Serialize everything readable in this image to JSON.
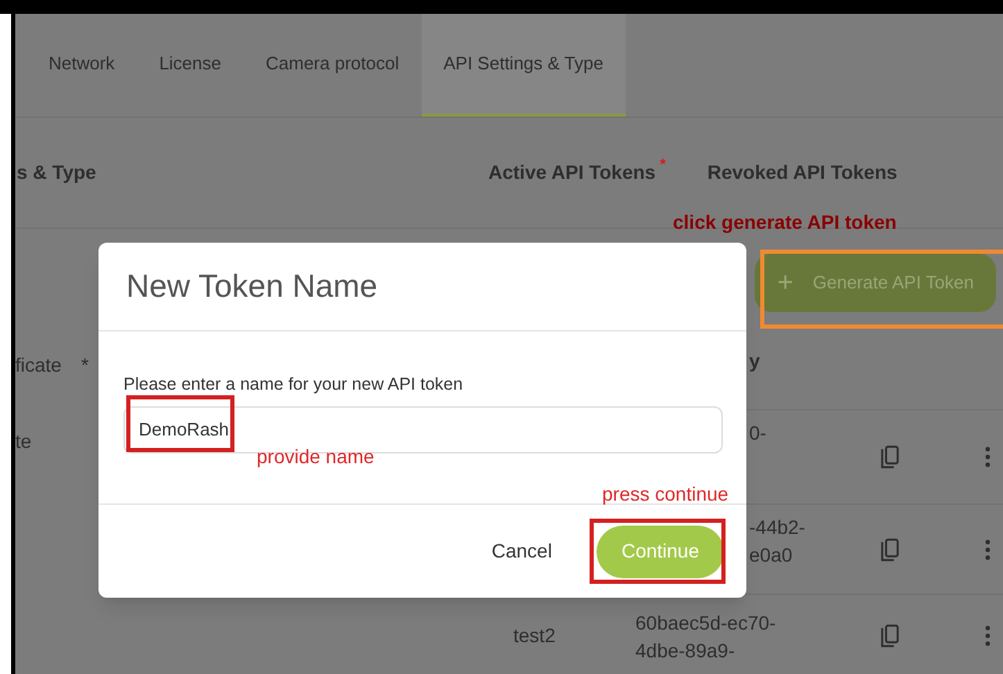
{
  "tabs": [
    {
      "label": "Network",
      "selected": false
    },
    {
      "label": "License",
      "selected": false
    },
    {
      "label": "Camera protocol",
      "selected": false
    },
    {
      "label": "API Settings & Type",
      "selected": true
    }
  ],
  "section_title": "s & Type",
  "token_tabs": [
    {
      "label": "Active API Tokens",
      "mark": "*"
    },
    {
      "label": "Revoked API Tokens"
    }
  ],
  "generate_button": {
    "icon": "+",
    "label": "Generate API Token"
  },
  "fields": [
    {
      "label": "ficate",
      "mark": "*"
    },
    {
      "label": "te"
    }
  ],
  "table": {
    "columns": [
      "y"
    ],
    "rows": [
      {
        "kind": "partial",
        "token": [
          "0-"
        ]
      },
      {
        "kind": "partial",
        "token": [
          "-44b2-",
          "e0a0"
        ]
      },
      {
        "kind": "full",
        "name": "test2",
        "token": [
          "60baec5d-ec70-",
          "4dbe-89a9-"
        ]
      }
    ]
  },
  "modal": {
    "title": "New Token Name",
    "prompt": "Please enter a name for your new API token",
    "value": "DemoRash",
    "buttons": [
      {
        "label": "Cancel",
        "kind": "text"
      },
      {
        "label": "Continue",
        "kind": "primary"
      }
    ]
  },
  "annotations": [
    {
      "text": "click generate API token",
      "kind": "generate"
    },
    {
      "text": "provide name",
      "kind": "name"
    },
    {
      "text": "press continue",
      "kind": "continue"
    }
  ]
}
